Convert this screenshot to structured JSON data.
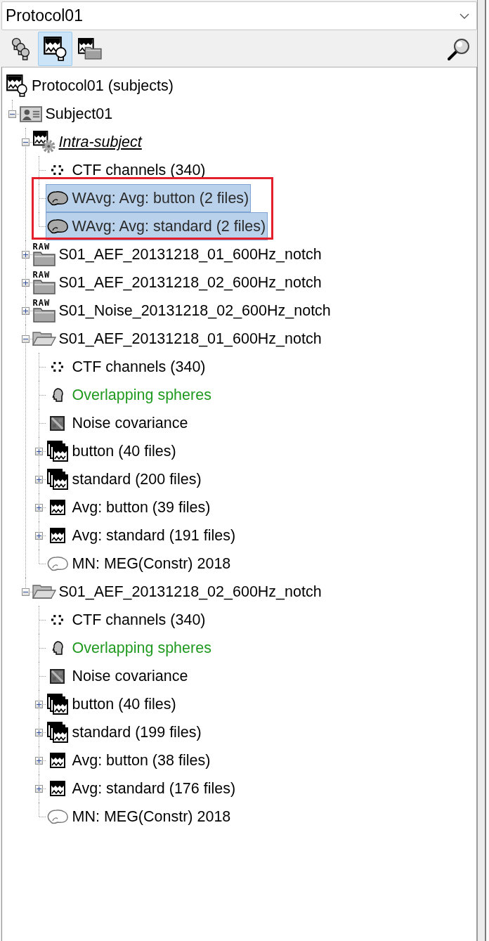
{
  "protocol_selector": {
    "value": "Protocol01"
  },
  "toolbar": {
    "views": [
      {
        "kind": "anatomy",
        "selected": false
      },
      {
        "kind": "subjects",
        "selected": true
      },
      {
        "kind": "conditions",
        "selected": false
      }
    ]
  },
  "tree": [
    {
      "label": "Protocol01 (subjects)",
      "kind": "protocol",
      "selected": false,
      "children": [
        {
          "label": "Subject01",
          "kind": "subject",
          "expanded": true,
          "selected": false,
          "children": [
            {
              "label": "Intra-subject",
              "kind": "analysis",
              "expanded": true,
              "selected": false,
              "children": [
                {
                  "label": "CTF channels (340)",
                  "kind": "channels",
                  "selected": false
                },
                {
                  "label": "WAvg: Avg: button (2 files)",
                  "kind": "results",
                  "selected": true,
                  "framed": true
                },
                {
                  "label": "WAvg: Avg: standard (2 files)",
                  "kind": "results",
                  "selected": true,
                  "framed": true
                }
              ]
            },
            {
              "label": "S01_AEF_20131218_01_600Hz_notch",
              "kind": "raw",
              "icon_label": "RAW",
              "expanded": false,
              "selected": false
            },
            {
              "label": "S01_AEF_20131218_02_600Hz_notch",
              "kind": "raw",
              "icon_label": "RAW",
              "expanded": false,
              "selected": false
            },
            {
              "label": "S01_Noise_20131218_02_600Hz_notch",
              "kind": "raw",
              "icon_label": "RAW",
              "expanded": false,
              "selected": false
            },
            {
              "label": "S01_AEF_20131218_01_600Hz_notch",
              "kind": "folder",
              "expanded": true,
              "selected": false,
              "children": [
                {
                  "label": "CTF channels (340)",
                  "kind": "channels",
                  "selected": false
                },
                {
                  "label": "Overlapping spheres",
                  "kind": "headmodel",
                  "default": true,
                  "selected": false
                },
                {
                  "label": "Noise covariance",
                  "kind": "noisecov",
                  "selected": false
                },
                {
                  "label": "button (40 files)",
                  "kind": "datalist",
                  "expanded": false,
                  "selected": false
                },
                {
                  "label": "standard (200 files)",
                  "kind": "datalist",
                  "expanded": false,
                  "selected": false
                },
                {
                  "label": "Avg: button (39 files)",
                  "kind": "data",
                  "expanded": false,
                  "selected": false
                },
                {
                  "label": "Avg: standard (191 files)",
                  "kind": "data",
                  "expanded": false,
                  "selected": false
                },
                {
                  "label": "MN: MEG(Constr) 2018",
                  "kind": "kernel",
                  "selected": false
                }
              ]
            },
            {
              "label": "S01_AEF_20131218_02_600Hz_notch",
              "kind": "folder",
              "expanded": true,
              "selected": false,
              "children": [
                {
                  "label": "CTF channels (340)",
                  "kind": "channels",
                  "selected": false
                },
                {
                  "label": "Overlapping spheres",
                  "kind": "headmodel",
                  "default": true,
                  "selected": false
                },
                {
                  "label": "Noise covariance",
                  "kind": "noisecov",
                  "selected": false
                },
                {
                  "label": "button (40 files)",
                  "kind": "datalist",
                  "expanded": false,
                  "selected": false
                },
                {
                  "label": "standard (199 files)",
                  "kind": "datalist",
                  "expanded": false,
                  "selected": false
                },
                {
                  "label": "Avg: button (38 files)",
                  "kind": "data",
                  "expanded": false,
                  "selected": false
                },
                {
                  "label": "Avg: standard (176 files)",
                  "kind": "data",
                  "expanded": false,
                  "selected": false
                },
                {
                  "label": "MN: MEG(Constr) 2018",
                  "kind": "kernel",
                  "selected": false
                }
              ]
            }
          ]
        }
      ]
    }
  ]
}
